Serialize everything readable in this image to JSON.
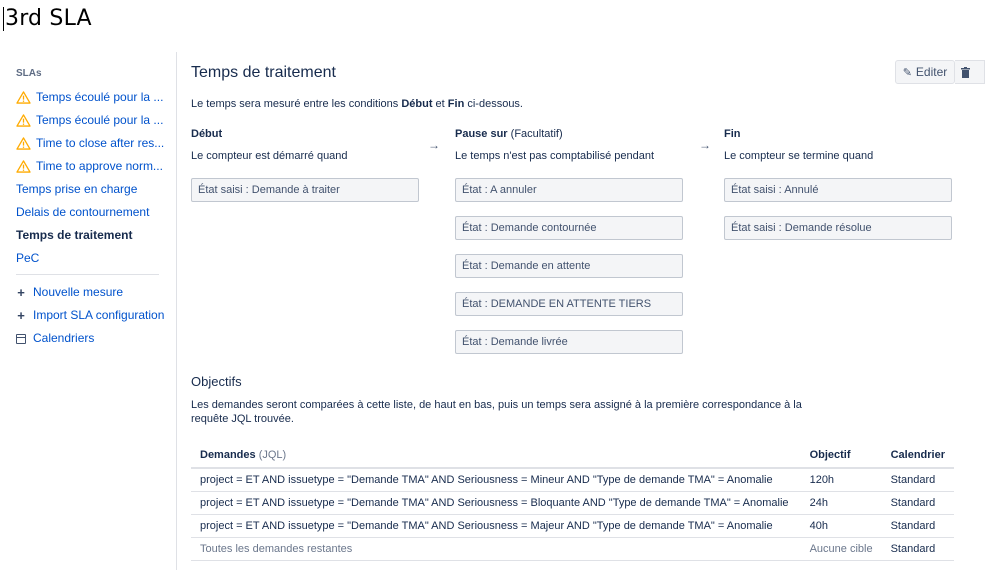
{
  "doc": {
    "title": "3rd SLA"
  },
  "sidebar": {
    "heading": "SLAs",
    "items": [
      {
        "label": "Temps écoulé pour la ...",
        "warning": true
      },
      {
        "label": "Temps écoulé pour la ...",
        "warning": true
      },
      {
        "label": "Time to close after res...",
        "warning": true
      },
      {
        "label": "Time to approve norm...",
        "warning": true
      },
      {
        "label": "Temps prise en charge",
        "warning": false
      },
      {
        "label": "Delais de contournement",
        "warning": false
      },
      {
        "label": "Temps de traitement",
        "warning": false,
        "active": true
      },
      {
        "label": "PeC",
        "warning": false
      }
    ],
    "actions": {
      "new_measure": "Nouvelle mesure",
      "import_config": "Import SLA configuration",
      "calendars": "Calendriers"
    }
  },
  "main": {
    "title": "Temps de traitement",
    "edit_label": "Editer",
    "intro": {
      "pre": "Le temps sera mesuré entre les conditions ",
      "start": "Début",
      "mid": " et ",
      "end": "Fin",
      "post": " ci-dessous."
    },
    "start": {
      "title": "Début",
      "subtitle": "Le compteur est démarré quand",
      "conditions": [
        "État saisi : Demande à traiter"
      ]
    },
    "pause": {
      "title": "Pause sur",
      "optional": " (Facultatif)",
      "subtitle": "Le temps n'est pas comptabilisé pendant",
      "conditions": [
        "État : A annuler",
        "État : Demande contournée",
        "État : Demande en attente",
        "État : DEMANDE EN ATTENTE TIERS",
        "État : Demande livrée"
      ]
    },
    "stop": {
      "title": "Fin",
      "subtitle": "Le compteur se termine quand",
      "conditions": [
        "État saisi : Annulé",
        "État saisi : Demande résolue"
      ]
    },
    "arrow": "→",
    "objectives": {
      "title": "Objectifs",
      "description": "Les demandes seront comparées à cette liste, de haut en bas, puis un temps sera assigné à la première correspondance à la requête JQL trouvée.",
      "headers": {
        "requests": "Demandes",
        "jql": " (JQL)",
        "goal": "Objectif",
        "calendar": "Calendrier"
      },
      "rows": [
        {
          "query": "project = ET AND issuetype = \"Demande TMA\" AND Seriousness = Mineur AND \"Type de demande TMA\" = Anomalie",
          "goal": "120h",
          "calendar": "Standard"
        },
        {
          "query": "project = ET AND issuetype = \"Demande TMA\" AND Seriousness = Bloquante AND \"Type de demande TMA\" = Anomalie",
          "goal": "24h",
          "calendar": "Standard"
        },
        {
          "query": "project = ET AND issuetype = \"Demande TMA\" AND Seriousness = Majeur AND \"Type de demande TMA\" = Anomalie",
          "goal": "40h",
          "calendar": "Standard"
        },
        {
          "query": "Toutes les demandes restantes",
          "goal": "Aucune cible",
          "calendar": "Standard"
        }
      ]
    }
  },
  "colors": {
    "link": "#0052cc",
    "warning": "#ffab00",
    "text": "#172b4d"
  }
}
